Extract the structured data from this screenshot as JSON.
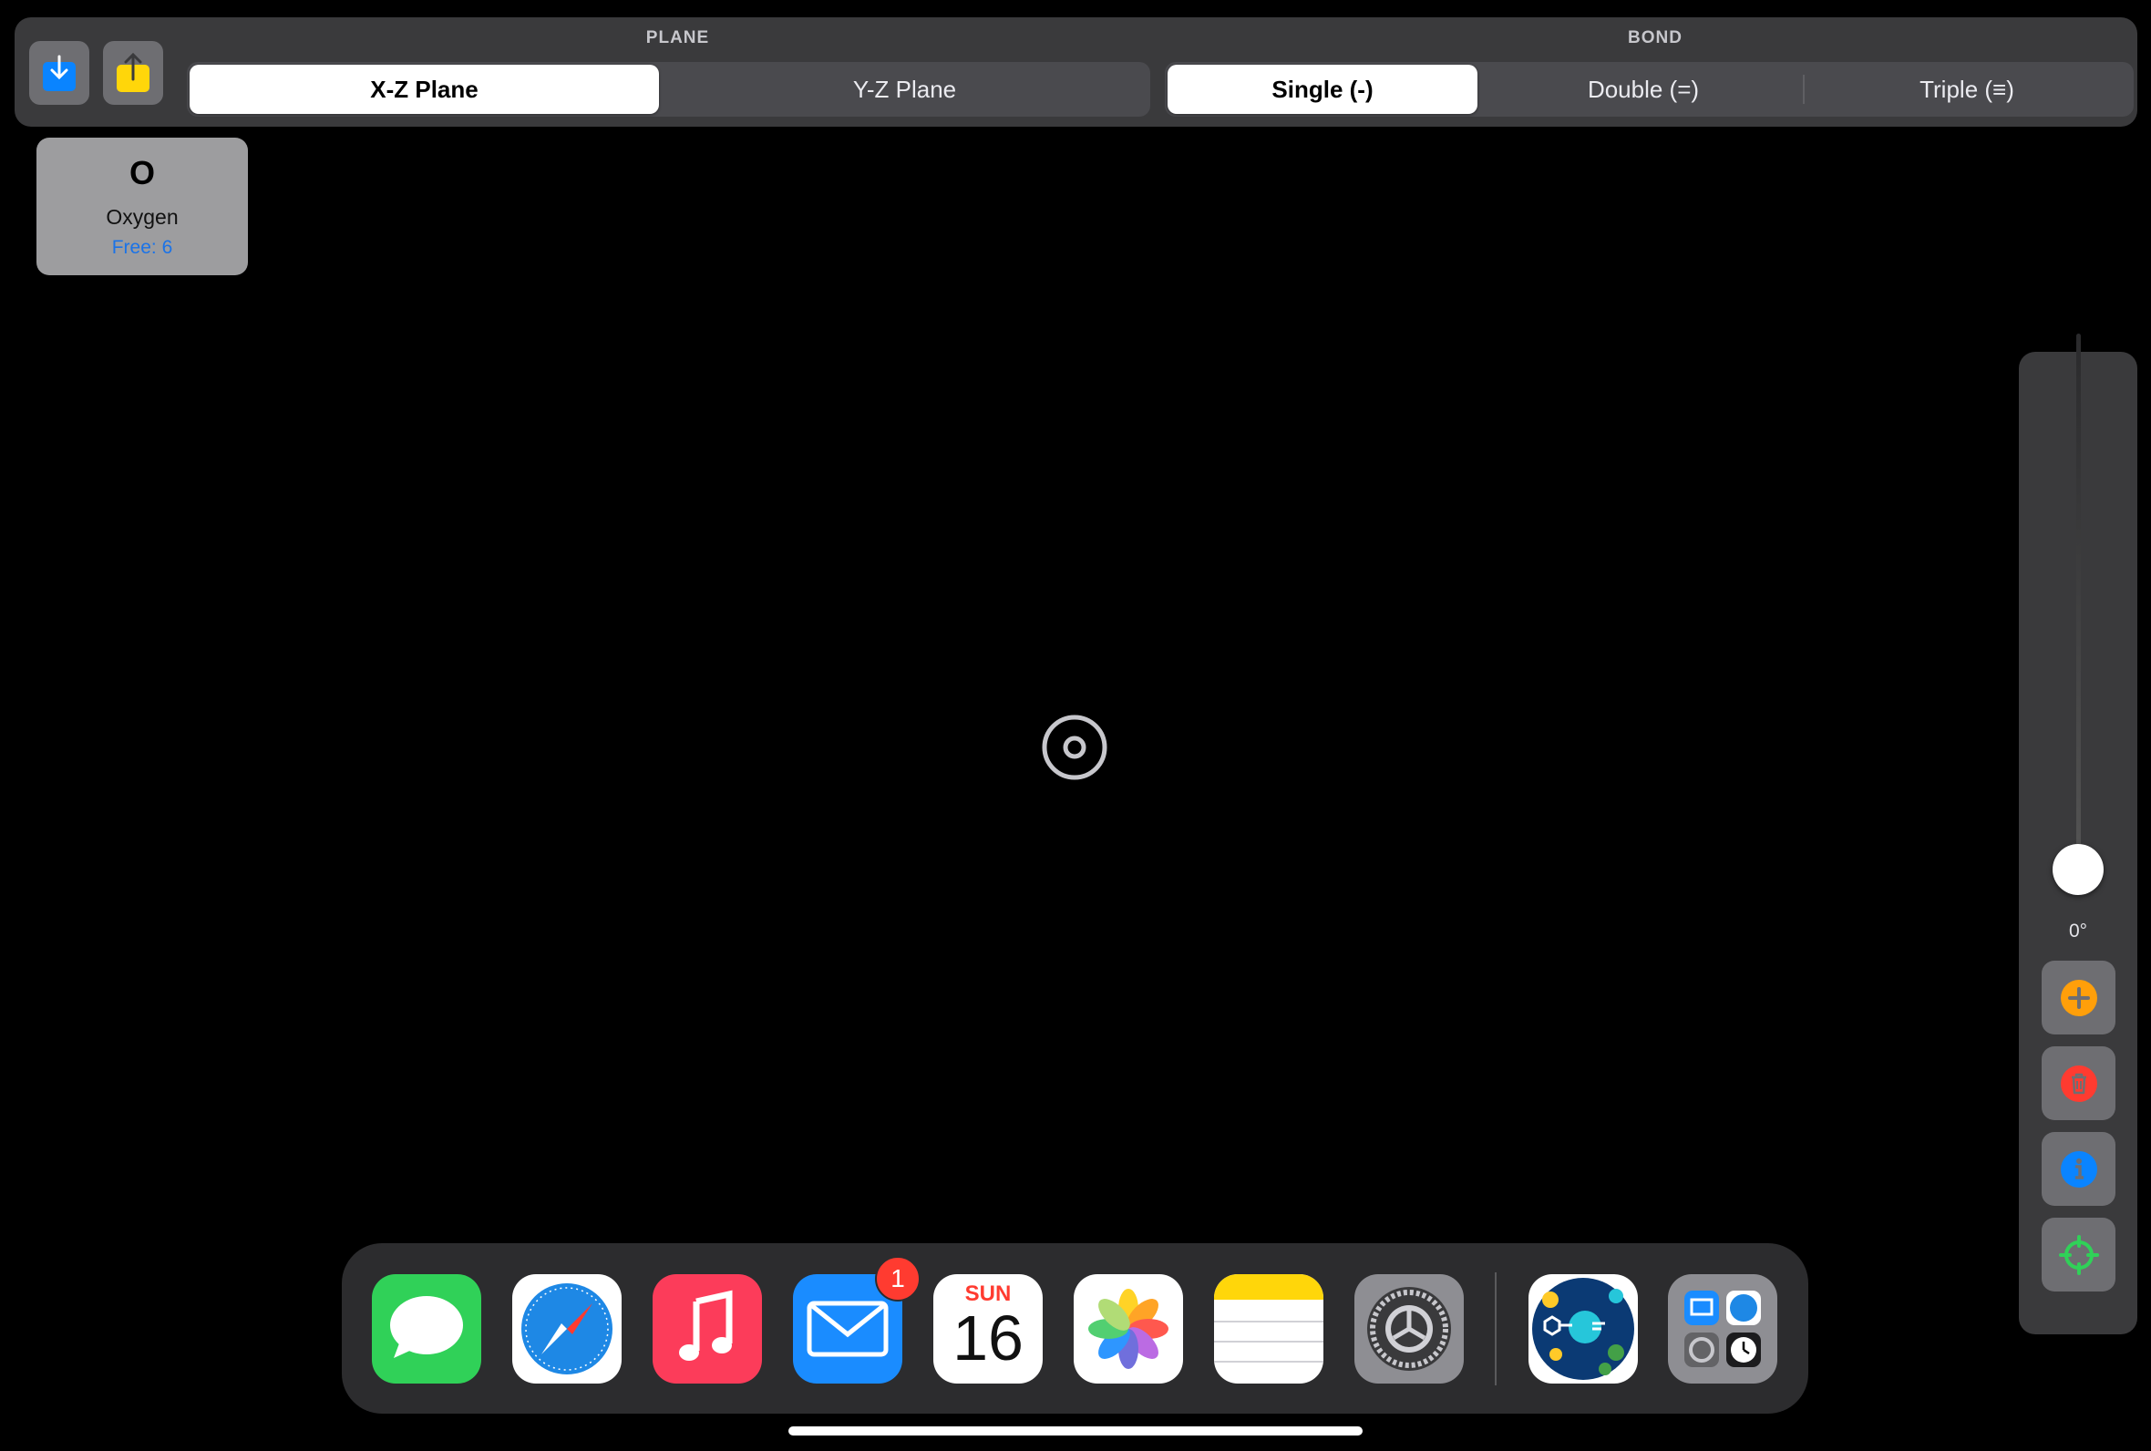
{
  "toolbar": {
    "plane_label": "PLANE",
    "bond_label": "BOND",
    "plane_options": [
      "X-Z Plane",
      "Y-Z Plane"
    ],
    "plane_selected": "X-Z Plane",
    "bond_options": [
      "Single (-)",
      "Double (=)",
      "Triple (≡)"
    ],
    "bond_selected": "Single (-)",
    "import_icon": "download-tray-icon",
    "export_icon": "share-upload-icon"
  },
  "element": {
    "symbol": "O",
    "name": "Oxygen",
    "free": "Free: 6"
  },
  "rotation": {
    "angle": "0°"
  },
  "side_buttons": [
    "add-icon",
    "trash-icon",
    "info-icon",
    "crosshair-icon"
  ],
  "dock": {
    "apps": [
      "Messages",
      "Safari",
      "Music",
      "Mail",
      "Calendar",
      "Photos",
      "Notes",
      "Settings",
      "Molecule App",
      "App Library"
    ],
    "mail_badge": "1",
    "calendar_month": "SUN",
    "calendar_day": "16"
  },
  "colors": {
    "accent_blue": "#0a84ff",
    "accent_yellow": "#ffd60a",
    "add_orange": "#ff9f0a",
    "delete_red": "#ff3b30",
    "target_green": "#30d158"
  }
}
